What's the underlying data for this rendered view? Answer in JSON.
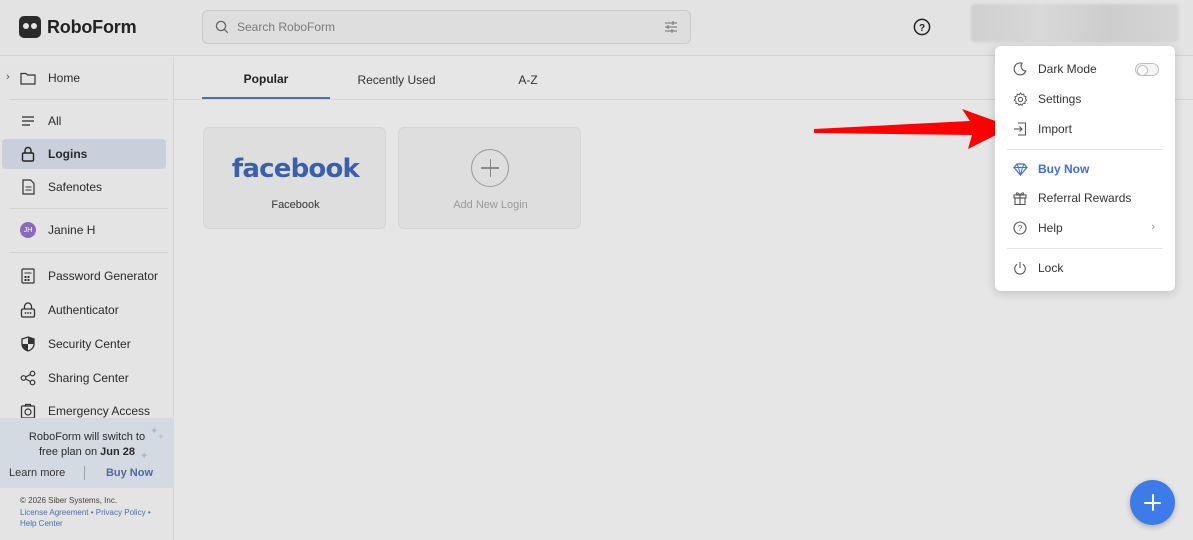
{
  "app": {
    "name": "RoboForm"
  },
  "search": {
    "placeholder": "Search RoboForm"
  },
  "sidebar": {
    "home": "Home",
    "all": "All",
    "logins": "Logins",
    "safenotes": "Safenotes",
    "user": {
      "initials": "JH",
      "name": "Janine H"
    },
    "tools": [
      "Password Generator",
      "Authenticator",
      "Security Center",
      "Sharing Center",
      "Emergency Access"
    ]
  },
  "promo": {
    "line1": "RoboForm will switch to",
    "line2_prefix": "free plan on",
    "line2_date": "Jun 28",
    "learn_more": "Learn more",
    "buy_now": "Buy Now"
  },
  "footer": {
    "copyright": "© 2026 Siber Systems, Inc.",
    "license": "License Agreement",
    "privacy": "Privacy Policy",
    "bullet": "•",
    "help_center": "Help Center"
  },
  "tabs": [
    "Popular",
    "Recently Used",
    "A-Z"
  ],
  "cards": [
    {
      "logo": "facebook",
      "label": "Facebook"
    },
    {
      "label": "Add New Login"
    }
  ],
  "menu": {
    "dark_mode": "Dark Mode",
    "dark_mode_on": false,
    "settings": "Settings",
    "import": "Import",
    "buy_now": "Buy Now",
    "referral": "Referral Rewards",
    "help": "Help",
    "lock": "Lock"
  },
  "colors": {
    "accent": "#3d7be8",
    "arrow": "#ff0000",
    "facebook": "#3b5faa"
  }
}
